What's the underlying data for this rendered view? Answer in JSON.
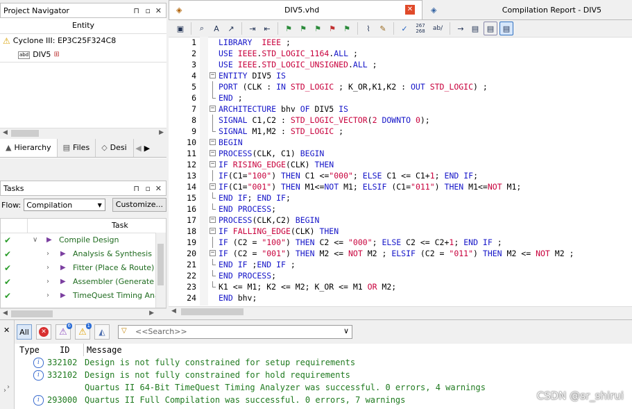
{
  "navigator": {
    "title": "Project Navigator",
    "column": "Entity",
    "device": "Cyclone III: EP3C25F324C8",
    "top_entity": "DIV5",
    "tabs": [
      {
        "label": "Hierarchy"
      },
      {
        "label": "Files"
      },
      {
        "label": "Desi"
      }
    ]
  },
  "tasks": {
    "title": "Tasks",
    "flow_label": "Flow:",
    "flow_value": "Compilation",
    "customize_label": "Customize...",
    "column": "Task",
    "items": [
      {
        "label": "Compile Design",
        "level": 0
      },
      {
        "label": "Analysis & Synthesis",
        "level": 1
      },
      {
        "label": "Fitter (Place & Route)",
        "level": 1
      },
      {
        "label": "Assembler (Generate pr",
        "level": 1
      },
      {
        "label": "TimeQuest Timing Analy:",
        "level": 1
      }
    ]
  },
  "editor": {
    "file_tab": "DIV5.vhd",
    "report_tab": "Compilation Report - DIV5",
    "toolbar_lines": "267\n268",
    "toolbar_ab": "ab/",
    "lines": [
      {
        "n": "1",
        "fold": "",
        "text": [
          [
            "kw",
            "LIBRARY"
          ],
          [
            "",
            "  "
          ],
          [
            "ty",
            "IEEE"
          ],
          [
            "",
            " ;"
          ]
        ]
      },
      {
        "n": "2",
        "fold": "",
        "text": [
          [
            "kw",
            "USE"
          ],
          [
            "",
            " "
          ],
          [
            "ty",
            "IEEE"
          ],
          [
            "",
            "."
          ],
          [
            "ty",
            "STD_LOGIC_1164"
          ],
          [
            "",
            "."
          ],
          [
            "kw",
            "ALL"
          ],
          [
            "",
            " ;"
          ]
        ]
      },
      {
        "n": "3",
        "fold": "",
        "text": [
          [
            "kw",
            "USE"
          ],
          [
            "",
            " "
          ],
          [
            "ty",
            "IEEE"
          ],
          [
            "",
            "."
          ],
          [
            "ty",
            "STD_LOGIC_UNSIGNED"
          ],
          [
            "",
            "."
          ],
          [
            "kw",
            "ALL"
          ],
          [
            "",
            " ;"
          ]
        ]
      },
      {
        "n": "4",
        "fold": "box",
        "text": [
          [
            "kw",
            "ENTITY"
          ],
          [
            "",
            " DIV5 "
          ],
          [
            "kw",
            "IS"
          ]
        ]
      },
      {
        "n": "5",
        "fold": "line",
        "text": [
          [
            "kw",
            "PORT"
          ],
          [
            "",
            " (CLK : "
          ],
          [
            "kw",
            "IN"
          ],
          [
            "",
            " "
          ],
          [
            "ty",
            "STD_LOGIC"
          ],
          [
            "",
            " ; K_OR,K1,K2 : "
          ],
          [
            "kw",
            "OUT"
          ],
          [
            "",
            " "
          ],
          [
            "ty",
            "STD_LOGIC"
          ],
          [
            "",
            ") ;"
          ]
        ]
      },
      {
        "n": "6",
        "fold": "end",
        "text": [
          [
            "kw",
            "END"
          ],
          [
            "",
            " ;"
          ]
        ]
      },
      {
        "n": "7",
        "fold": "box",
        "text": [
          [
            "kw",
            "ARCHITECTURE"
          ],
          [
            "",
            " bhv "
          ],
          [
            "kw",
            "OF"
          ],
          [
            "",
            " DIV5 "
          ],
          [
            "kw",
            "IS"
          ]
        ]
      },
      {
        "n": "8",
        "fold": "line",
        "text": [
          [
            "kw",
            "SIGNAL"
          ],
          [
            "",
            " C1,C2 : "
          ],
          [
            "ty",
            "STD_LOGIC_VECTOR"
          ],
          [
            "",
            "("
          ],
          [
            "st",
            "2"
          ],
          [
            "",
            " "
          ],
          [
            "kw",
            "DOWNTO"
          ],
          [
            "",
            " "
          ],
          [
            "st",
            "0"
          ],
          [
            "",
            ");"
          ]
        ]
      },
      {
        "n": "9",
        "fold": "end",
        "text": [
          [
            "kw",
            "SIGNAL"
          ],
          [
            "",
            " M1,M2 : "
          ],
          [
            "ty",
            "STD_LOGIC"
          ],
          [
            "",
            " ;"
          ]
        ]
      },
      {
        "n": "10",
        "fold": "box",
        "text": [
          [
            "kw",
            "BEGIN"
          ]
        ]
      },
      {
        "n": "11",
        "fold": "box",
        "text": [
          [
            "kw",
            "PROCESS"
          ],
          [
            "",
            "(CLK, C1) "
          ],
          [
            "kw",
            "BEGIN"
          ]
        ]
      },
      {
        "n": "12",
        "fold": "box",
        "text": [
          [
            "kw",
            "IF"
          ],
          [
            "",
            " "
          ],
          [
            "ty",
            "RISING_EDGE"
          ],
          [
            "",
            "(CLK) "
          ],
          [
            "kw",
            "THEN"
          ]
        ]
      },
      {
        "n": "13",
        "fold": "line",
        "text": [
          [
            "kw",
            "IF"
          ],
          [
            "",
            "(C1="
          ],
          [
            "st",
            "\"100\""
          ],
          [
            "",
            ") "
          ],
          [
            "kw",
            "THEN"
          ],
          [
            "",
            " C1 <="
          ],
          [
            "st",
            "\"000\""
          ],
          [
            "",
            "; "
          ],
          [
            "kw",
            "ELSE"
          ],
          [
            "",
            " C1 <= C1+"
          ],
          [
            "st",
            "1"
          ],
          [
            "",
            "; "
          ],
          [
            "kw",
            "END IF"
          ],
          [
            "",
            ";"
          ]
        ]
      },
      {
        "n": "14",
        "fold": "box",
        "text": [
          [
            "kw",
            "IF"
          ],
          [
            "",
            "(C1="
          ],
          [
            "st",
            "\"001\""
          ],
          [
            "",
            ") "
          ],
          [
            "kw",
            "THEN"
          ],
          [
            "",
            " M1<="
          ],
          [
            "kw",
            "NOT"
          ],
          [
            "",
            " M1; "
          ],
          [
            "kw",
            "ELSIF"
          ],
          [
            "",
            " (C1="
          ],
          [
            "st",
            "\"011\""
          ],
          [
            "",
            ") "
          ],
          [
            "kw",
            "THEN"
          ],
          [
            "",
            " M1<="
          ],
          [
            "st",
            "NOT"
          ],
          [
            "",
            " M1;"
          ]
        ]
      },
      {
        "n": "15",
        "fold": "end",
        "text": [
          [
            "kw",
            "END IF"
          ],
          [
            "",
            "; "
          ],
          [
            "kw",
            "END IF"
          ],
          [
            "",
            ";"
          ]
        ]
      },
      {
        "n": "16",
        "fold": "end",
        "text": [
          [
            "kw",
            "END PROCESS"
          ],
          [
            "",
            ";"
          ]
        ]
      },
      {
        "n": "17",
        "fold": "box",
        "text": [
          [
            "kw",
            "PROCESS"
          ],
          [
            "",
            "(CLK,C2) "
          ],
          [
            "kw",
            "BEGIN"
          ]
        ]
      },
      {
        "n": "18",
        "fold": "box",
        "text": [
          [
            "kw",
            "IF"
          ],
          [
            "",
            " "
          ],
          [
            "ty",
            "FALLING_EDGE"
          ],
          [
            "",
            "(CLK) "
          ],
          [
            "kw",
            "THEN"
          ]
        ]
      },
      {
        "n": "19",
        "fold": "line",
        "text": [
          [
            "kw",
            "IF"
          ],
          [
            "",
            " (C2 = "
          ],
          [
            "st",
            "\"100\""
          ],
          [
            "",
            ") "
          ],
          [
            "kw",
            "THEN"
          ],
          [
            "",
            " C2 <= "
          ],
          [
            "st",
            "\"000\""
          ],
          [
            "",
            "; "
          ],
          [
            "kw",
            "ELSE"
          ],
          [
            "",
            " C2 <= C2+"
          ],
          [
            "st",
            "1"
          ],
          [
            "",
            "; "
          ],
          [
            "kw",
            "END IF"
          ],
          [
            "",
            " ;"
          ]
        ]
      },
      {
        "n": "20",
        "fold": "box",
        "text": [
          [
            "kw",
            "IF"
          ],
          [
            "",
            " (C2 = "
          ],
          [
            "st",
            "\"001\""
          ],
          [
            "",
            ") "
          ],
          [
            "kw",
            "THEN"
          ],
          [
            "",
            " M2 <= "
          ],
          [
            "st",
            "NOT"
          ],
          [
            "",
            " M2 ; "
          ],
          [
            "kw",
            "ELSIF"
          ],
          [
            "",
            " (C2 = "
          ],
          [
            "st",
            "\"011\""
          ],
          [
            "",
            ") "
          ],
          [
            "kw",
            "THEN"
          ],
          [
            "",
            " M2 <= "
          ],
          [
            "st",
            "NOT"
          ],
          [
            "",
            " M2 ;"
          ]
        ]
      },
      {
        "n": "21",
        "fold": "end",
        "text": [
          [
            "kw",
            "END IF"
          ],
          [
            "",
            " ;"
          ],
          [
            "kw",
            "END IF"
          ],
          [
            "",
            " ;"
          ]
        ]
      },
      {
        "n": "22",
        "fold": "end",
        "text": [
          [
            "kw",
            "END PROCESS"
          ],
          [
            "",
            ";"
          ]
        ]
      },
      {
        "n": "23",
        "fold": "end",
        "text": [
          [
            "",
            "K1 <= M1; K2 <= M2; K_OR <= M1 "
          ],
          [
            "st",
            "OR"
          ],
          [
            "",
            " M2;"
          ]
        ]
      },
      {
        "n": "24",
        "fold": "",
        "text": [
          [
            "kw",
            "END"
          ],
          [
            "",
            " bhv;"
          ]
        ]
      }
    ]
  },
  "messages": {
    "filter_all": "All",
    "badge_warn_crit": "6",
    "badge_warn": "1",
    "search_placeholder": "<<Search>>",
    "columns": {
      "type": "Type",
      "id": "ID",
      "message": "Message"
    },
    "rows": [
      {
        "id": "332102",
        "text": "Design is not fully constrained for setup requirements",
        "icon": true,
        "expand": false
      },
      {
        "id": "332102",
        "text": "Design is not fully constrained for hold requirements",
        "icon": true,
        "expand": false
      },
      {
        "id": "",
        "text": "Quartus II 64-Bit TimeQuest Timing Analyzer was successful. 0 errors, 4 warnings",
        "icon": false,
        "expand": true
      },
      {
        "id": "293000",
        "text": "Quartus II Full Compilation was successful. 0 errors, 7 warnings",
        "icon": true,
        "expand": false
      }
    ],
    "watermark": "CSDN @sr_shirui"
  }
}
